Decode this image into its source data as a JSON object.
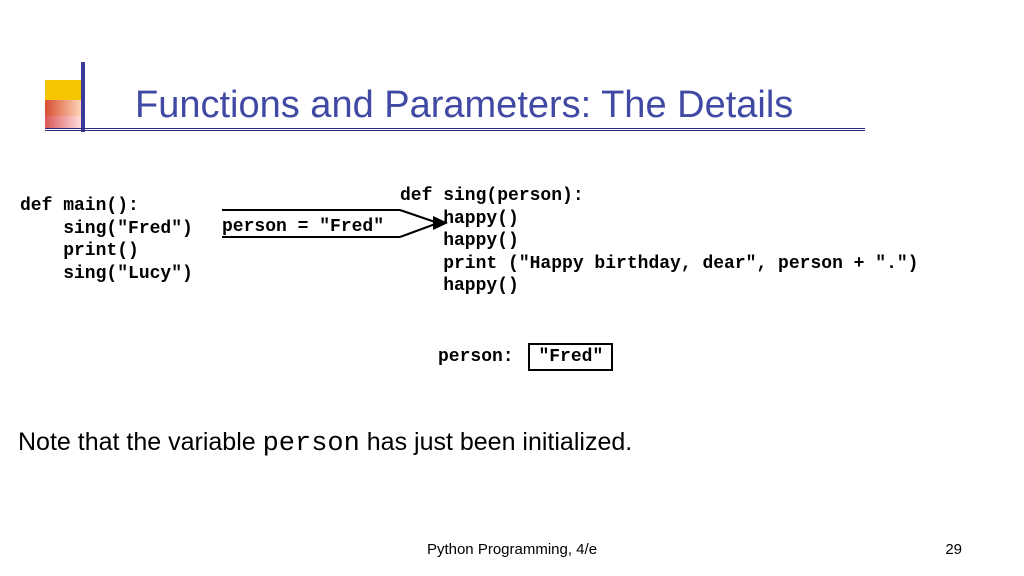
{
  "title": "Functions and Parameters: The Details",
  "code": {
    "main_def": "def main():",
    "main_l1": "    sing(\"Fred\")",
    "main_l2": "    print()",
    "main_l3": "    sing(\"Lucy\")",
    "sing_def": "def sing(person):",
    "sing_l1": "    happy()",
    "sing_l2": "    happy()",
    "sing_l3": "    print (\"Happy birthday, dear\", person + \".\")",
    "sing_l4": "    happy()",
    "assign": "person = \"Fred\""
  },
  "var_display": {
    "label": "person:",
    "value": "\"Fred\""
  },
  "note": {
    "pre": "Note that the variable ",
    "code": "person",
    "post": " has just been initialized."
  },
  "footer": "Python Programming, 4/e",
  "page": "29"
}
